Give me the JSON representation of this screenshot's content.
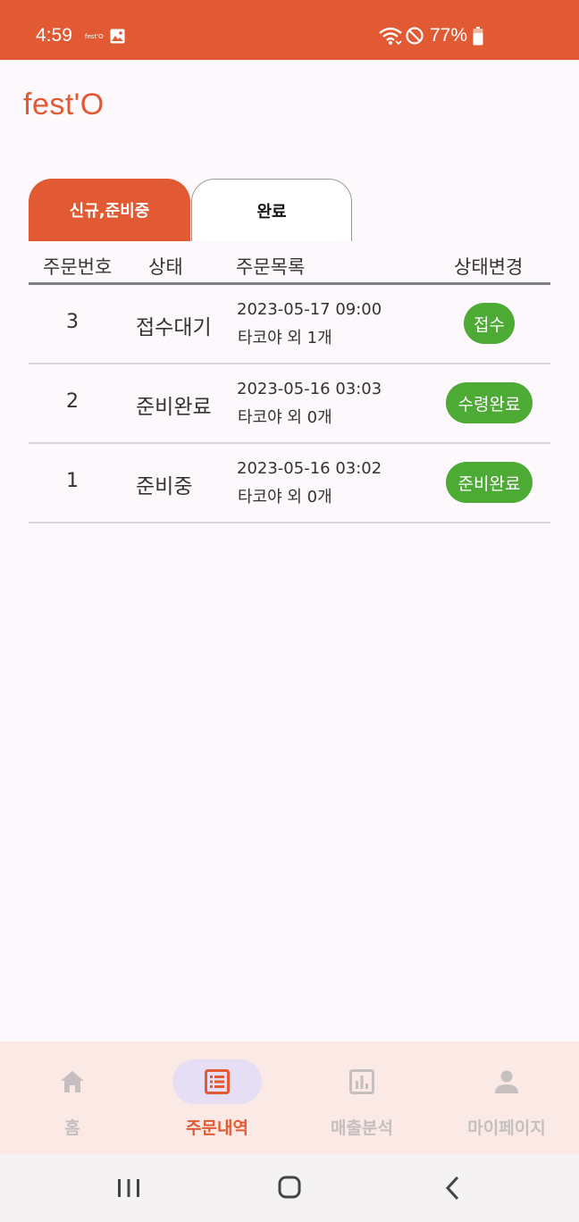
{
  "status_bar": {
    "time": "4:59",
    "mini_app": "fest'O",
    "battery": "77%",
    "icons": [
      "gallery-icon",
      "wifi-icon",
      "do-not-disturb-icon",
      "battery-icon"
    ]
  },
  "app": {
    "title": "fest'O",
    "accent": "#e15a33",
    "button_green": "#4caa35"
  },
  "tabs": [
    {
      "label": "신규,준비중",
      "active": true
    },
    {
      "label": "완료",
      "active": false
    }
  ],
  "table": {
    "headers": [
      "주문번호",
      "상태",
      "주문목록",
      "상태변경"
    ],
    "rows": [
      {
        "number": "3",
        "status": "접수대기",
        "datetime": "2023-05-17  09:00",
        "summary": "타코야 외 1개",
        "action": "접수"
      },
      {
        "number": "2",
        "status": "준비완료",
        "datetime": "2023-05-16  03:03",
        "summary": "타코야 외 0개",
        "action": "수령완료"
      },
      {
        "number": "1",
        "status": "준비중",
        "datetime": "2023-05-16  03:02",
        "summary": "타코야 외 0개",
        "action": "준비완료"
      }
    ]
  },
  "bottom_nav": [
    {
      "label": "홈",
      "icon": "home-icon",
      "active": false
    },
    {
      "label": "주문내역",
      "icon": "order-list-icon",
      "active": true
    },
    {
      "label": "매출분석",
      "icon": "chart-icon",
      "active": false
    },
    {
      "label": "마이페이지",
      "icon": "person-icon",
      "active": false
    }
  ],
  "system_nav": [
    "recent-apps-icon",
    "home-button-icon",
    "back-icon"
  ]
}
